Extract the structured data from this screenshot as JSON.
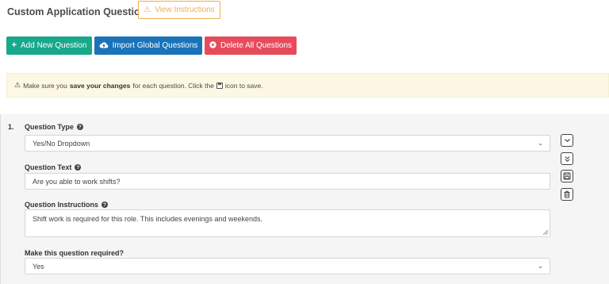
{
  "header": {
    "title": "Custom Application Questions",
    "view_instructions_label": "View Instructions"
  },
  "toolbar": {
    "add_label": "Add New Question",
    "import_label": "Import Global Questions",
    "delete_label": "Delete All Questions"
  },
  "alert": {
    "text_before": "Make sure you",
    "bold_text": "save your changes",
    "text_middle": "for each question. Click the",
    "text_after": "icon to save."
  },
  "questions": [
    {
      "number": "1.",
      "type_label": "Question Type",
      "type_value": "Yes/No Dropdown",
      "text_label": "Question Text",
      "text_value": "Are you able to work shifts?",
      "instructions_label": "Question Instructions",
      "instructions_value": "Shift work is required for this role. This includes evenings and weekends.",
      "required_label": "Make this question required?",
      "required_value": "Yes"
    }
  ],
  "icons": {
    "warning": "warning-triangle-icon",
    "add": "plus-icon",
    "import": "cloud-upload-icon",
    "delete": "times-circle-icon",
    "help": "question-circle-icon",
    "move_down": "chevron-down-icon",
    "move_bottom": "double-chevron-down-icon",
    "save": "save-icon",
    "trash": "trash-icon"
  },
  "colors": {
    "add_button": "#18a88b",
    "import_button": "#1a73b8",
    "delete_button": "#e64b5c",
    "warning": "#f0ad4e",
    "alert_bg": "#fcf8e3"
  }
}
